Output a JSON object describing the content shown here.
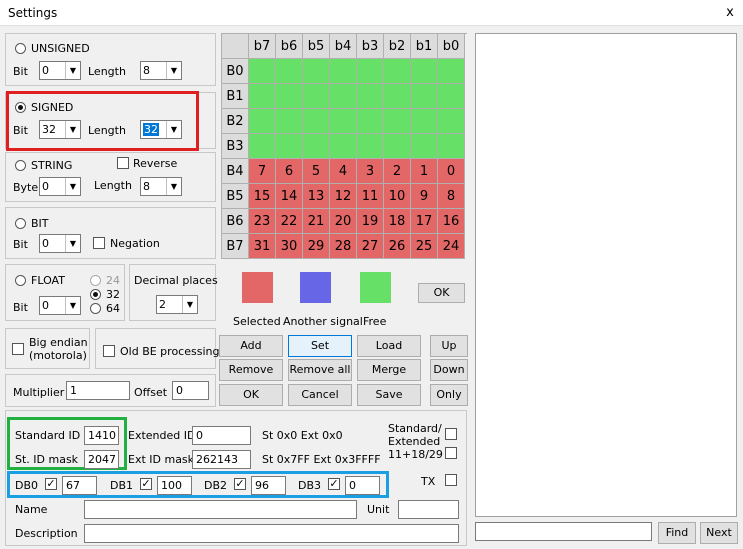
{
  "window": {
    "title": "Settings",
    "close": "x"
  },
  "unsigned": {
    "label": "UNSIGNED",
    "bit_label": "Bit",
    "bit": "0",
    "length_label": "Length",
    "length": "8"
  },
  "signed": {
    "label": "SIGNED",
    "bit_label": "Bit",
    "bit": "32",
    "length_label": "Length",
    "length": "32"
  },
  "string": {
    "label": "STRING",
    "reverse_label": "Reverse",
    "byte_label": "Byte",
    "byte": "0",
    "length_label": "Length",
    "length": "8"
  },
  "bit": {
    "label": "BIT",
    "bit_label": "Bit",
    "bit": "0",
    "negation_label": "Negation"
  },
  "float": {
    "label": "FLOAT",
    "bit_label": "Bit",
    "bit": "0",
    "opt24": "24",
    "opt32": "32",
    "opt64": "64"
  },
  "decimal": {
    "label": "Decimal places",
    "value": "2"
  },
  "endian": {
    "big_label": "Big endian\n(motorola)",
    "old_label": "Old BE processing"
  },
  "multiplier": {
    "label": "Multiplier",
    "value": "1",
    "offset_label": "Offset",
    "offset": "0"
  },
  "grid": {
    "headers": [
      "b7",
      "b6",
      "b5",
      "b4",
      "b3",
      "b2",
      "b1",
      "b0"
    ],
    "rows": [
      {
        "label": "B0",
        "state": "free",
        "cells": [
          "",
          "",
          "",
          "",
          "",
          "",
          "",
          ""
        ]
      },
      {
        "label": "B1",
        "state": "free",
        "cells": [
          "",
          "",
          "",
          "",
          "",
          "",
          "",
          ""
        ]
      },
      {
        "label": "B2",
        "state": "free",
        "cells": [
          "",
          "",
          "",
          "",
          "",
          "",
          "",
          ""
        ]
      },
      {
        "label": "B3",
        "state": "free",
        "cells": [
          "",
          "",
          "",
          "",
          "",
          "",
          "",
          ""
        ]
      },
      {
        "label": "B4",
        "state": "selected",
        "cells": [
          "7",
          "6",
          "5",
          "4",
          "3",
          "2",
          "1",
          "0"
        ]
      },
      {
        "label": "B5",
        "state": "selected",
        "cells": [
          "15",
          "14",
          "13",
          "12",
          "11",
          "10",
          "9",
          "8"
        ]
      },
      {
        "label": "B6",
        "state": "selected",
        "cells": [
          "23",
          "22",
          "21",
          "20",
          "19",
          "18",
          "17",
          "16"
        ]
      },
      {
        "label": "B7",
        "state": "selected",
        "cells": [
          "31",
          "30",
          "29",
          "28",
          "27",
          "26",
          "25",
          "24"
        ]
      }
    ]
  },
  "legend": {
    "selected": "Selected",
    "another": "Another signal",
    "free": "Free",
    "ok": "OK"
  },
  "colors": {
    "selected": "#e36767",
    "another": "#6666e6",
    "free": "#66e066"
  },
  "buttons": {
    "add": "Add",
    "set": "Set",
    "load": "Load",
    "up": "Up",
    "remove": "Remove",
    "remove_all": "Remove all",
    "merge": "Merge",
    "down": "Down",
    "ok": "OK",
    "cancel": "Cancel",
    "save": "Save",
    "only": "Only"
  },
  "ids": {
    "std_label": "Standard ID",
    "std": "1410",
    "ext_label": "Extended ID",
    "ext": "0",
    "std_range": "St 0x0 Ext 0x0",
    "std_ext_label": "Standard/\nExtended\n11+18/29",
    "stmask_label": "St. ID mask",
    "stmask": "2047",
    "extmask_label": "Ext ID mask",
    "extmask": "262143",
    "mask_range": "St 0x7FF Ext 0x3FFFF",
    "tx_label": "TX"
  },
  "db": [
    {
      "label": "DB0",
      "value": "67"
    },
    {
      "label": "DB1",
      "value": "100"
    },
    {
      "label": "DB2",
      "value": "96"
    },
    {
      "label": "DB3",
      "value": "0"
    }
  ],
  "name_label": "Name",
  "name": "",
  "unit_label": "Unit",
  "unit": "",
  "desc_label": "Description",
  "desc": "",
  "find": {
    "value": "",
    "find": "Find",
    "next": "Next"
  }
}
